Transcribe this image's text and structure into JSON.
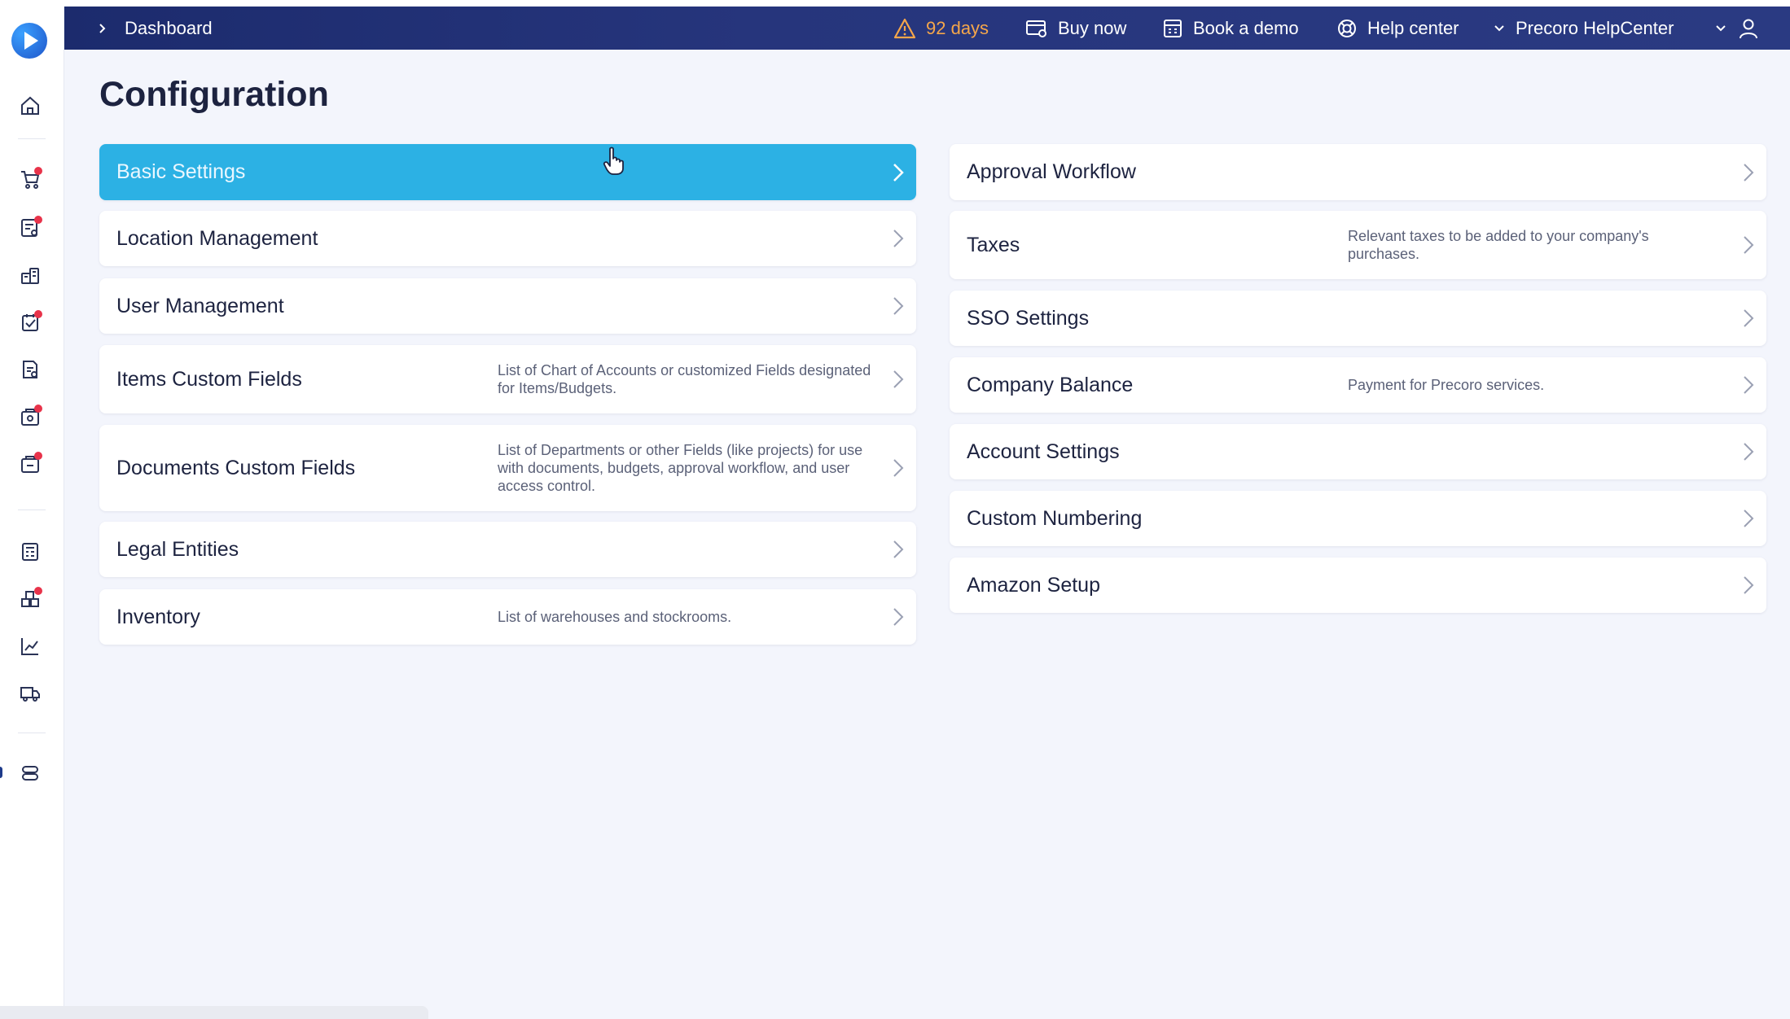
{
  "header": {
    "breadcrumb": "Dashboard",
    "trial": "92 days",
    "buy_now": "Buy now",
    "book_demo": "Book a demo",
    "help_center": "Help center",
    "company": "Precoro HelpCenter"
  },
  "page": {
    "title": "Configuration"
  },
  "left_cards": [
    {
      "label": "Basic Settings",
      "desc": ""
    },
    {
      "label": "Location Management",
      "desc": ""
    },
    {
      "label": "User Management",
      "desc": ""
    },
    {
      "label": "Items Custom Fields",
      "desc": "List of Chart of Accounts or customized Fields designated for Items/Budgets."
    },
    {
      "label": "Documents Custom Fields",
      "desc": "List of Departments or other Fields (like projects) for use with documents, budgets, approval workflow, and user access control."
    },
    {
      "label": "Legal Entities",
      "desc": ""
    },
    {
      "label": "Inventory",
      "desc": "List of warehouses and stockrooms."
    }
  ],
  "right_cards": [
    {
      "label": "Approval Workflow",
      "desc": ""
    },
    {
      "label": "Taxes",
      "desc": "Relevant taxes to be added to your company's purchases."
    },
    {
      "label": "SSO Settings",
      "desc": ""
    },
    {
      "label": "Company Balance",
      "desc": "Payment for Precoro services."
    },
    {
      "label": "Account Settings",
      "desc": ""
    },
    {
      "label": "Custom Numbering",
      "desc": ""
    },
    {
      "label": "Amazon Setup",
      "desc": ""
    }
  ],
  "sidebar_icons": [
    "home-icon",
    "cart-icon",
    "requests-icon",
    "suppliers-icon",
    "approvals-icon",
    "invoices-icon",
    "receipts-icon",
    "payments-icon",
    "budgets-icon",
    "catalog-icon",
    "analytics-icon",
    "delivery-icon",
    "settings-icon"
  ],
  "colors": {
    "header_bg": "#1c2b6d",
    "active_card": "#2cb1e4",
    "warning": "#f5a64a",
    "badge": "#e8334a"
  }
}
